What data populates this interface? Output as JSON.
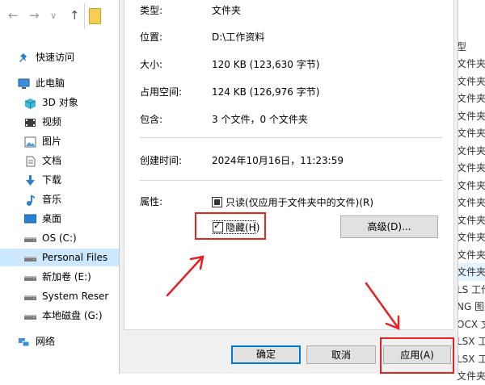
{
  "sidebar": {
    "items": [
      {
        "label": "快速访问",
        "icon": "pin-icon"
      },
      {
        "label": "此电脑",
        "icon": "computer-icon"
      },
      {
        "label": "3D 对象",
        "icon": "cube-icon"
      },
      {
        "label": "视频",
        "icon": "video-icon"
      },
      {
        "label": "图片",
        "icon": "picture-icon"
      },
      {
        "label": "文档",
        "icon": "document-icon"
      },
      {
        "label": "下载",
        "icon": "download-icon"
      },
      {
        "label": "音乐",
        "icon": "music-icon"
      },
      {
        "label": "桌面",
        "icon": "desktop-icon"
      },
      {
        "label": "OS (C:)",
        "icon": "drive-icon"
      },
      {
        "label": "Personal Files",
        "icon": "drive-icon"
      },
      {
        "label": "新加卷 (E:)",
        "icon": "drive-icon"
      },
      {
        "label": "System Reser",
        "icon": "drive-icon"
      },
      {
        "label": "本地磁盘 (G:)",
        "icon": "drive-icon"
      },
      {
        "label": "网络",
        "icon": "network-icon"
      }
    ],
    "selected_index": 10
  },
  "file_list": {
    "type_header": "型",
    "rows": [
      "文件夹",
      "文件夹",
      "文件夹",
      "文件夹",
      "文件夹",
      "文件夹",
      "文件夹",
      "文件夹",
      "文件夹",
      "文件夹",
      "文件夹",
      "文件夹",
      "文件夹",
      "LS 工作",
      "NG 图片",
      "OCX 文",
      "LSX 工",
      "LSX 工",
      "文件夹"
    ]
  },
  "properties": {
    "type_label": "类型:",
    "type_value": "文件夹",
    "location_label": "位置:",
    "location_value": "D:\\工作资料",
    "size_label": "大小:",
    "size_value": "120 KB (123,630 字节)",
    "disk_size_label": "占用空间:",
    "disk_size_value": "124 KB (126,976 字节)",
    "contains_label": "包含:",
    "contains_value": "3 个文件，0 个文件夹",
    "created_label": "创建时间:",
    "created_value": "2024年10月16日，11:23:59",
    "attributes_label": "属性:",
    "readonly_label": "只读(仅应用于文件夹中的文件)(R)",
    "hidden_label": "隐藏(H)",
    "advanced_button": "高级(D)...",
    "hidden_checked": true,
    "readonly_partial": true
  },
  "dialog_buttons": {
    "ok": "确定",
    "cancel": "取消",
    "apply": "应用(A)"
  },
  "colors": {
    "annotation": "#e32222",
    "selection": "#cce8ff",
    "accent": "#0078d7"
  }
}
